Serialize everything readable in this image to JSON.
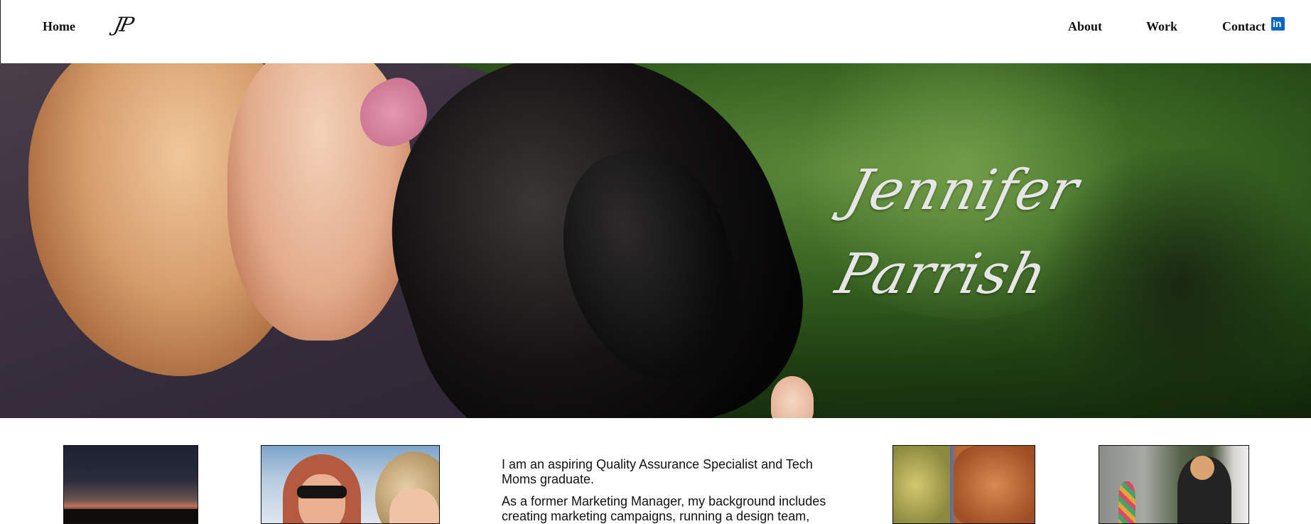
{
  "header": {
    "home_label": "Home",
    "logo_text": "JP",
    "nav": {
      "about_label": "About",
      "work_label": "Work",
      "contact_label": "Contact"
    },
    "linkedin_icon_text": "in",
    "linkedin_icon": "linkedin-icon",
    "linkedin_color": "#0a66c2"
  },
  "hero": {
    "name_first": "Jennifer",
    "name_last": "Parrish"
  },
  "bio": {
    "paragraph_1": "I am an aspiring Quality Assurance Specialist and Tech Moms graduate.",
    "paragraph_2": "As a former Marketing Manager, my background includes creating marketing campaigns, running a design team,"
  }
}
